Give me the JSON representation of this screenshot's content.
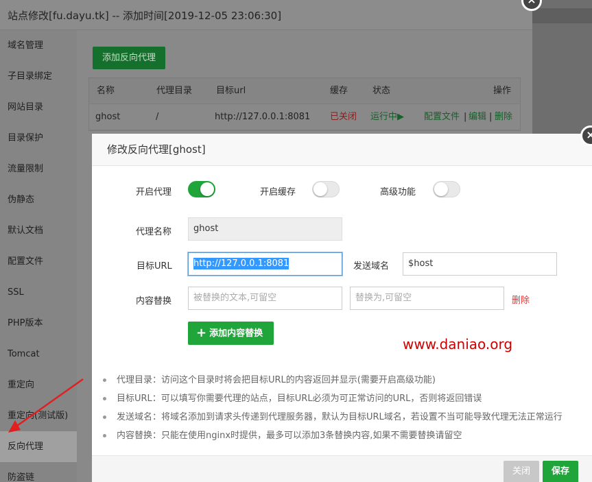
{
  "window": {
    "title": "站点修改[fu.dayu.tk] -- 添加时间[2019-12-05 23:06:30]"
  },
  "sidebar": {
    "items": [
      {
        "label": "域名管理"
      },
      {
        "label": "子目录绑定"
      },
      {
        "label": "网站目录"
      },
      {
        "label": "目录保护"
      },
      {
        "label": "流量限制"
      },
      {
        "label": "伪静态"
      },
      {
        "label": "默认文档"
      },
      {
        "label": "配置文件"
      },
      {
        "label": "SSL"
      },
      {
        "label": "PHP版本"
      },
      {
        "label": "Tomcat"
      },
      {
        "label": "重定向"
      },
      {
        "label": "重定向(测试版)"
      },
      {
        "label": "反向代理"
      },
      {
        "label": "防盗链"
      }
    ],
    "active_index": 13
  },
  "main": {
    "add_button": "添加反向代理",
    "table": {
      "headers": {
        "name": "名称",
        "dir": "代理目录",
        "url": "目标url",
        "cache": "缓存",
        "status": "状态",
        "ops": "操作"
      },
      "rows": [
        {
          "name": "ghost",
          "dir": "/",
          "url": "http://127.0.0.1:8081",
          "cache": "已关闭",
          "status": "运行中▶",
          "op_config": "配置文件",
          "op_edit": "编辑",
          "op_delete": "删除",
          "sep": "|"
        }
      ]
    }
  },
  "modal": {
    "title": "修改反向代理[ghost]",
    "toggles": {
      "proxy": {
        "label": "开启代理",
        "on": true
      },
      "cache": {
        "label": "开启缓存",
        "on": false
      },
      "advanced": {
        "label": "高级功能",
        "on": false
      }
    },
    "fields": {
      "name_label": "代理名称",
      "name_value": "ghost",
      "target_label": "目标URL",
      "target_value": "http://127.0.0.1:8081",
      "send_domain_label": "发送域名",
      "send_domain_value": "$host",
      "replace_label": "内容替换",
      "replace_from_placeholder": "被替换的文本,可留空",
      "replace_to_placeholder": "替换为,可留空",
      "replace_delete": "删除"
    },
    "add_replace_button": "添加内容替换",
    "watermark": "www.daniao.org",
    "tips": [
      "代理目录：访问这个目录时将会把目标URL的内容返回并显示(需要开启高级功能)",
      "目标URL：可以填写你需要代理的站点，目标URL必须为可正常访问的URL，否则将返回错误",
      "发送域名：将域名添加到请求头传递到代理服务器，默认为目标URL域名，若设置不当可能导致代理无法正常运行",
      "内容替换：只能在使用nginx时提供，最多可以添加3条替换内容,如果不需要替换请留空"
    ],
    "close_button": "关闭",
    "save_button": "保存"
  },
  "colors": {
    "accent_green": "#20a53a",
    "danger_red": "#e33333",
    "annotation_red": "#cc0000"
  },
  "icons": {
    "close": "close-icon",
    "plus": "plus-icon",
    "arrow": "annotation-arrow"
  }
}
